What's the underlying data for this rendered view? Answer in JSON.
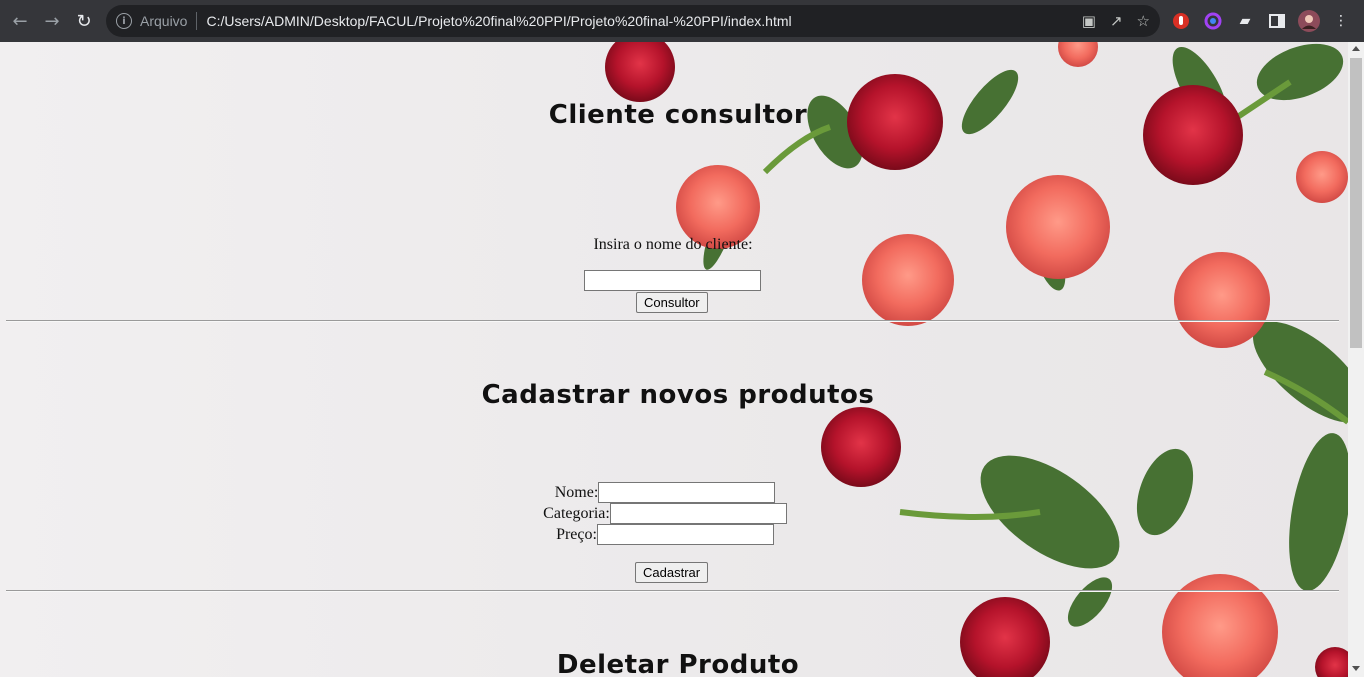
{
  "browser": {
    "back_icon": "back-arrow-icon",
    "forward_icon": "forward-arrow-icon",
    "reload_icon": "reload-icon",
    "scheme_label": "Arquivo",
    "url": "C:/Users/ADMIN/Desktop/FACUL/Projeto%20final%20PPI/Projeto%20final-%20PPI/index.html"
  },
  "sections": {
    "consult": {
      "title": "Cliente consultor",
      "prompt": "Insira o nome do cliente:",
      "button": "Consultor"
    },
    "register": {
      "title": "Cadastrar novos produtos",
      "name_label": "Nome:",
      "category_label": "Categoria:",
      "price_label": "Preço:",
      "button": "Cadastrar"
    },
    "delete": {
      "title": "Deletar Produto"
    }
  },
  "colors": {
    "toolbar": "#35363a",
    "omnibox": "#202124",
    "rose_red": "#b5132b",
    "rose_coral": "#f26b5e",
    "leaf": "#3f6b2a"
  }
}
